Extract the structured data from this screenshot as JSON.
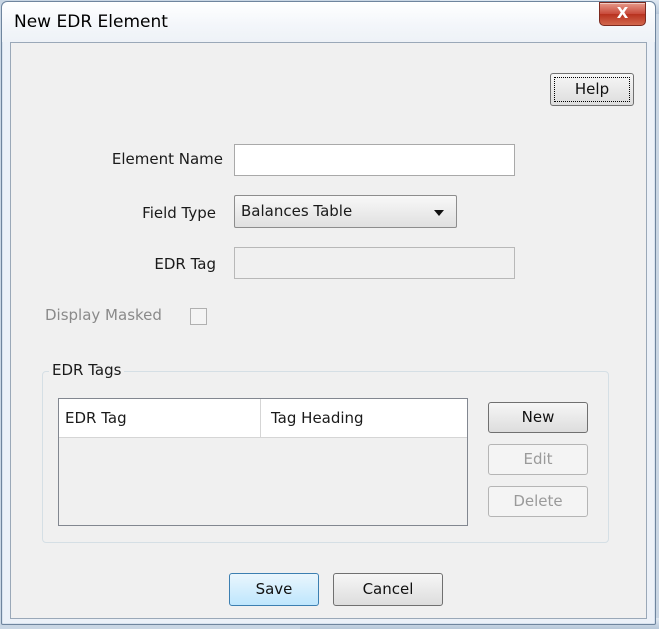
{
  "window": {
    "title": "New EDR Element",
    "close_glyph": "X"
  },
  "toolbar": {
    "help_label": "Help"
  },
  "form": {
    "element_name_label": "Element Name",
    "element_name_value": "",
    "field_type_label": "Field Type",
    "field_type_value": "Balances Table",
    "edr_tag_label": "EDR Tag",
    "edr_tag_value": "",
    "display_masked_label": "Display Masked",
    "display_masked_checked": false
  },
  "edr_tags_group": {
    "legend": "EDR Tags",
    "columns": [
      "EDR Tag",
      "Tag Heading"
    ],
    "rows": [],
    "new_label": "New",
    "edit_label": "Edit",
    "delete_label": "Delete"
  },
  "footer": {
    "save_label": "Save",
    "cancel_label": "Cancel"
  },
  "colors": {
    "window_border": "#6f859e",
    "client_bg": "#f0f0f0",
    "close_button": "#c8493a",
    "primary_button_border": "#3c7fb1"
  },
  "icons": {
    "close": "close-icon",
    "dropdown": "chevron-down-icon"
  }
}
